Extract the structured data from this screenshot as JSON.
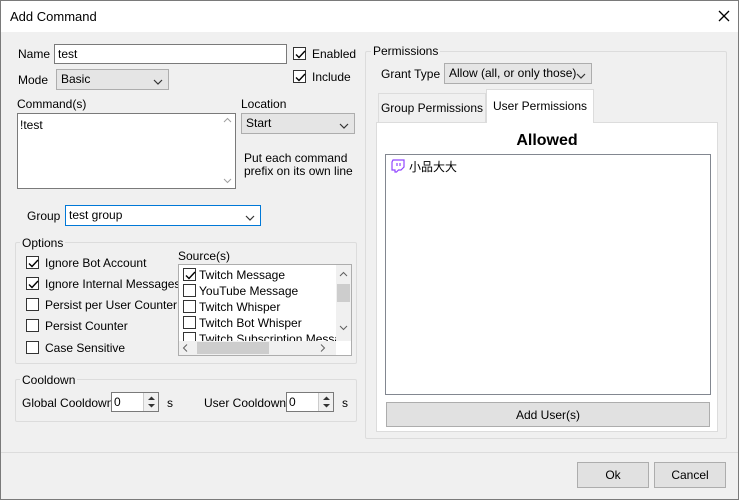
{
  "window": {
    "title": "Add Command"
  },
  "form": {
    "name_label": "Name",
    "name_value": "test",
    "mode_label": "Mode",
    "mode_value": "Basic",
    "enabled_label": "Enabled",
    "enabled_checked": true,
    "include_label": "Include",
    "include_checked": true,
    "commands_label": "Command(s)",
    "commands_value": "!test",
    "location_label": "Location",
    "location_value": "Start",
    "location_hint_1": "Put each command",
    "location_hint_2": "prefix on its own line",
    "group_label": "Group",
    "group_value": "test group"
  },
  "options": {
    "title": "Options",
    "checkboxes": [
      {
        "label": "Ignore Bot Account",
        "checked": true
      },
      {
        "label": "Ignore Internal Messages",
        "checked": true
      },
      {
        "label": "Persist per User Counter",
        "checked": false
      },
      {
        "label": "Persist Counter",
        "checked": false
      },
      {
        "label": "Case Sensitive",
        "checked": false
      }
    ],
    "sources_label": "Source(s)",
    "sources": [
      {
        "label": "Twitch Message",
        "checked": true
      },
      {
        "label": "YouTube Message",
        "checked": false
      },
      {
        "label": "Twitch Whisper",
        "checked": false
      },
      {
        "label": "Twitch Bot Whisper",
        "checked": false
      },
      {
        "label": "Twitch Subscription Message",
        "checked": false
      }
    ]
  },
  "cooldown": {
    "title": "Cooldown",
    "global_label": "Global Cooldown",
    "global_value": "0",
    "global_unit": "s",
    "user_label": "User Cooldown",
    "user_value": "0",
    "user_unit": "s"
  },
  "permissions": {
    "title": "Permissions",
    "grant_type_label": "Grant Type",
    "grant_type_value": "Allow (all, or only those)",
    "tabs": [
      {
        "label": "Group Permissions",
        "active": false
      },
      {
        "label": "User Permissions",
        "active": true
      }
    ],
    "allowed_heading": "Allowed",
    "allowed_users": [
      {
        "name": "小品大大",
        "icon": "twitch-icon"
      }
    ],
    "add_users_button": "Add User(s)"
  },
  "footer": {
    "ok_label": "Ok",
    "cancel_label": "Cancel"
  },
  "colors": {
    "twitch": "#9146ff",
    "accent_border": "#0078d7"
  }
}
